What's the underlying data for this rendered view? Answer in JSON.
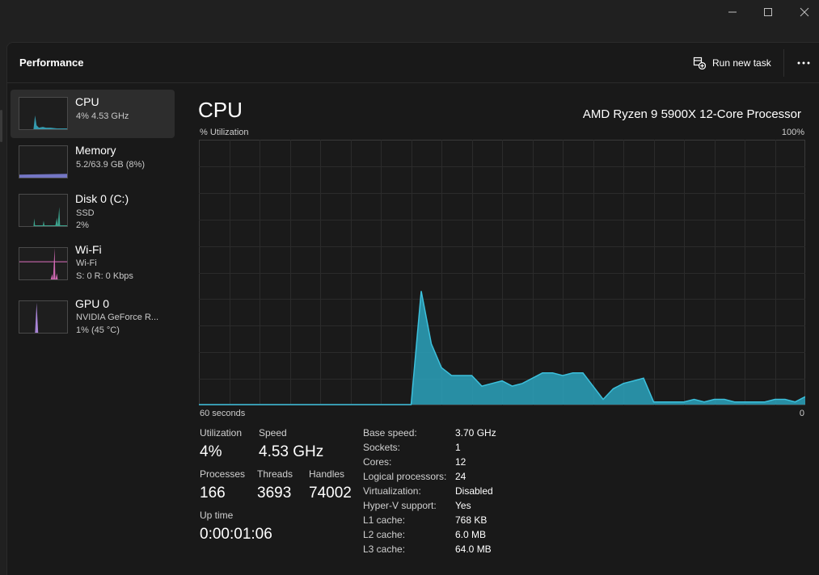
{
  "window": {
    "controls": [
      "minimize",
      "maximize",
      "close"
    ]
  },
  "header": {
    "title": "Performance",
    "run_new_task": "Run new task",
    "more_icon": "ellipsis-icon"
  },
  "sidebar": {
    "items": [
      {
        "title": "CPU",
        "sub1": "4% 4.53 GHz",
        "sub2": "",
        "color": "#3ab0c8",
        "selected": true
      },
      {
        "title": "Memory",
        "sub1": "5.2/63.9 GB (8%)",
        "sub2": "",
        "color": "#7d7fd6",
        "selected": false
      },
      {
        "title": "Disk 0 (C:)",
        "sub1": "SSD",
        "sub2": "2%",
        "color": "#3fb39a",
        "selected": false
      },
      {
        "title": "Wi-Fi",
        "sub1": "Wi-Fi",
        "sub2": "S: 0 R: 0 Kbps",
        "color": "#e070c0",
        "selected": false
      },
      {
        "title": "GPU 0",
        "sub1": "NVIDIA GeForce R...",
        "sub2": "1% (45 °C)",
        "color": "#b08ae0",
        "selected": false
      }
    ]
  },
  "cpu": {
    "heading": "CPU",
    "model": "AMD Ryzen 9 5900X 12-Core Processor",
    "axis_label": "% Utilization",
    "axis_max": "100%",
    "time_span": "60 seconds",
    "axis_min": "0",
    "graph_color": "#2ca3bd",
    "stats": {
      "utilization_label": "Utilization",
      "utilization": "4%",
      "speed_label": "Speed",
      "speed": "4.53 GHz",
      "processes_label": "Processes",
      "processes": "166",
      "threads_label": "Threads",
      "threads": "3693",
      "handles_label": "Handles",
      "handles": "74002",
      "uptime_label": "Up time",
      "uptime": "0:00:01:06"
    },
    "specs": [
      {
        "key": "Base speed:",
        "value": "3.70 GHz"
      },
      {
        "key": "Sockets:",
        "value": "1"
      },
      {
        "key": "Cores:",
        "value": "12"
      },
      {
        "key": "Logical processors:",
        "value": "24"
      },
      {
        "key": "Virtualization:",
        "value": "Disabled"
      },
      {
        "key": "Hyper-V support:",
        "value": "Yes"
      },
      {
        "key": "L1 cache:",
        "value": "768 KB"
      },
      {
        "key": "L2 cache:",
        "value": "6.0 MB"
      },
      {
        "key": "L3 cache:",
        "value": "64.0 MB"
      }
    ]
  },
  "chart_data": {
    "type": "area",
    "title": "",
    "xlabel": "60 seconds",
    "ylabel": "% Utilization",
    "xlim": [
      60,
      0
    ],
    "ylim": [
      0,
      100
    ],
    "grid": true,
    "x": [
      60,
      59,
      58,
      57,
      56,
      55,
      54,
      53,
      52,
      51,
      50,
      49,
      48,
      47,
      46,
      45,
      44,
      43,
      42,
      41,
      40,
      39,
      38,
      37,
      36,
      35,
      34,
      33,
      32,
      31,
      30,
      29,
      28,
      27,
      26,
      25,
      24,
      23,
      22,
      21,
      20,
      19,
      18,
      17,
      16,
      15,
      14,
      13,
      12,
      11,
      10,
      9,
      8,
      7,
      6,
      5,
      4,
      3,
      2,
      1,
      0
    ],
    "series": [
      {
        "values": [
          0,
          0,
          0,
          0,
          0,
          0,
          0,
          0,
          0,
          0,
          0,
          0,
          0,
          0,
          0,
          0,
          0,
          0,
          0,
          0,
          0,
          0,
          43,
          23,
          14,
          11,
          11,
          11,
          7,
          8,
          9,
          7,
          8,
          10,
          12,
          12,
          11,
          12,
          12,
          7,
          2,
          6,
          8,
          9,
          10,
          1,
          1,
          1,
          1,
          2,
          1,
          2,
          2,
          1,
          1,
          1,
          1,
          2,
          2,
          1,
          3
        ]
      }
    ]
  }
}
